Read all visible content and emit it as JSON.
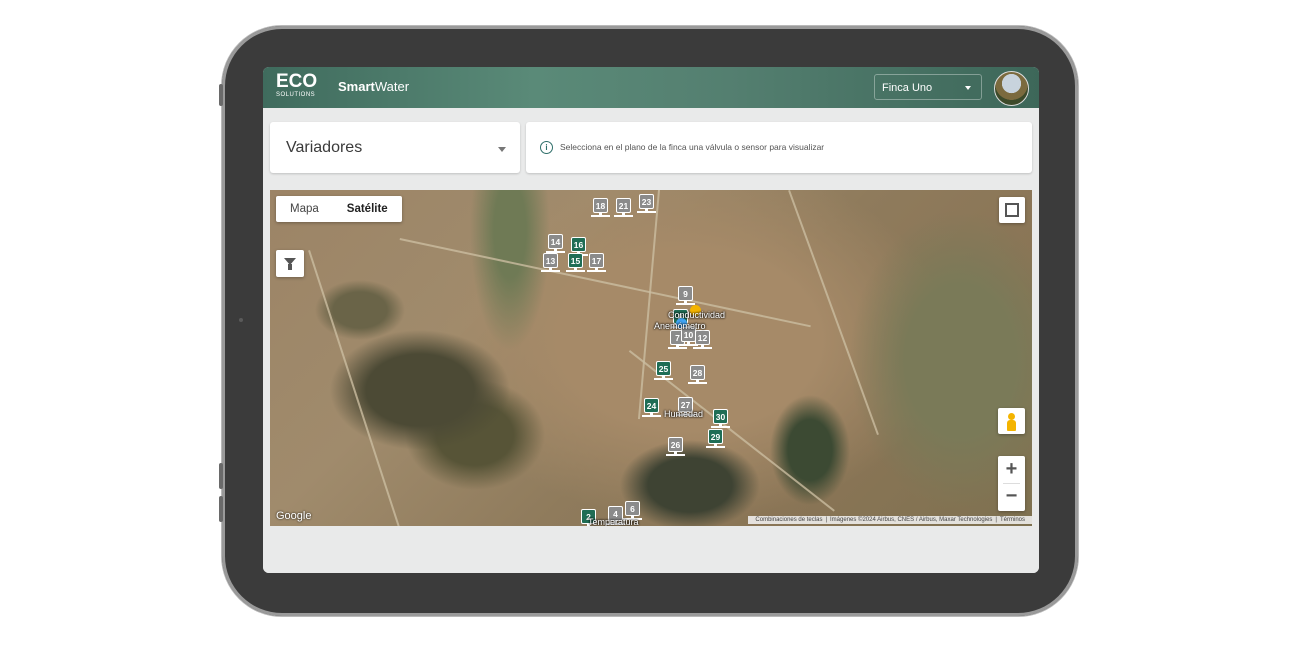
{
  "header": {
    "logo_text": "ECO",
    "logo_subtext": "SOLUTIONS",
    "app_name_bold": "Smart",
    "app_name_regular": "Water",
    "farm_select": "Finca Uno"
  },
  "selector": {
    "label": "Variadores"
  },
  "info": {
    "message": "Selecciona en el plano de la finca una válvula o sensor para visualizar"
  },
  "map": {
    "type_options": [
      "Mapa",
      "Satélite"
    ],
    "active_type": "Satélite",
    "google_label": "Google",
    "attribution": {
      "shortcuts": "Combinaciones de teclas",
      "imagery": "Imágenes ©2024 Airbus, CNES / Airbus, Maxar Technologies",
      "terms": "Términos"
    },
    "zoom_in": "+",
    "zoom_out": "−",
    "markers": [
      {
        "id": "18",
        "color": "gray"
      },
      {
        "id": "21",
        "color": "gray"
      },
      {
        "id": "23",
        "color": "gray"
      },
      {
        "id": "14",
        "color": "gray"
      },
      {
        "id": "16",
        "color": "green"
      },
      {
        "id": "13",
        "color": "gray"
      },
      {
        "id": "15",
        "color": "green"
      },
      {
        "id": "17",
        "color": "gray"
      },
      {
        "id": "9",
        "color": "gray"
      },
      {
        "id": "8",
        "color": "green"
      },
      {
        "id": "7",
        "color": "gray"
      },
      {
        "id": "10",
        "color": "gray"
      },
      {
        "id": "12",
        "color": "gray"
      },
      {
        "id": "25",
        "color": "green"
      },
      {
        "id": "28",
        "color": "gray"
      },
      {
        "id": "24",
        "color": "green"
      },
      {
        "id": "27",
        "color": "gray"
      },
      {
        "id": "30",
        "color": "green"
      },
      {
        "id": "29",
        "color": "green"
      },
      {
        "id": "26",
        "color": "gray"
      },
      {
        "id": "2",
        "color": "green"
      },
      {
        "id": "4",
        "color": "gray"
      },
      {
        "id": "6",
        "color": "gray"
      }
    ],
    "labels": {
      "conductividad": "Conductividad",
      "anemometro": "Anemómetro",
      "humedad": "Humedad",
      "temperatura": "Temperatura"
    }
  },
  "colors": {
    "header": "#4f7f6f",
    "marker_green": "#1f6d55",
    "marker_gray": "#8b8b8b"
  }
}
